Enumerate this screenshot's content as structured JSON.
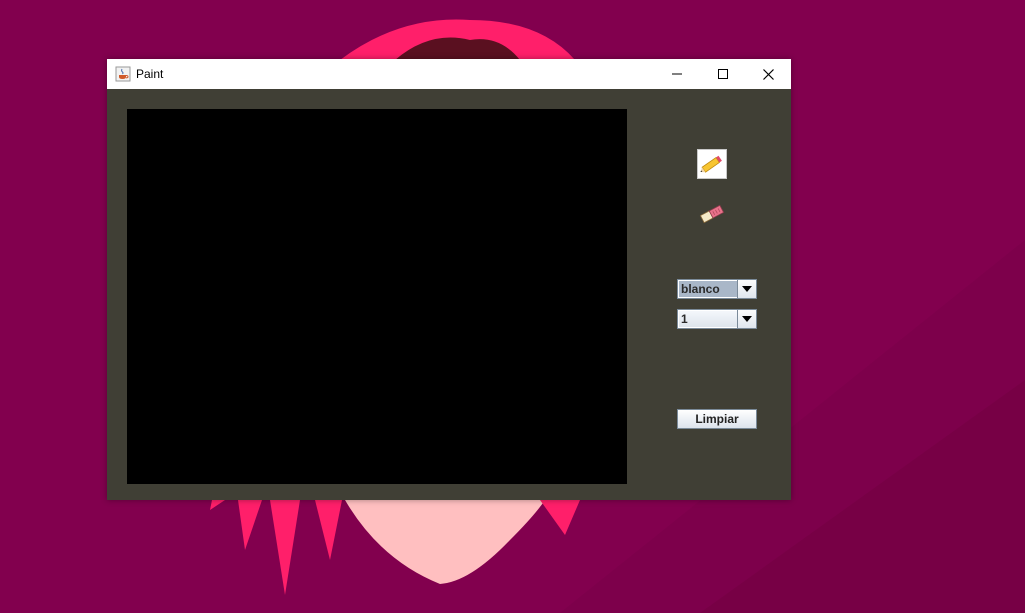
{
  "window": {
    "title": "Paint",
    "app_icon": "java-cup-icon",
    "controls": [
      "minimize-icon",
      "maximize-icon",
      "close-icon"
    ]
  },
  "toolbar": {
    "tools": [
      {
        "icon": "pencil-icon",
        "selected": true
      },
      {
        "icon": "eraser-icon",
        "selected": false
      }
    ],
    "color_select": {
      "value": "blanco"
    },
    "size_select": {
      "value": "1"
    },
    "clear_label": "Limpiar"
  },
  "colors": {
    "window_bg": "#403f35",
    "canvas_bg": "#000000",
    "desktop_bg": "#82004e",
    "titlebar_bg": "#ffffff"
  }
}
